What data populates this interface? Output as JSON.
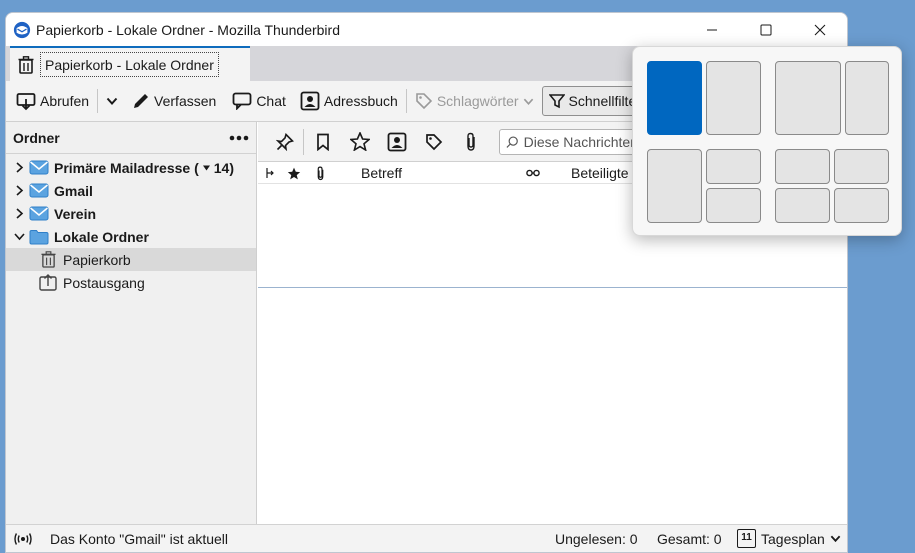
{
  "window": {
    "title": "Papierkorb - Lokale Ordner - Mozilla Thunderbird"
  },
  "tab": {
    "label": "Papierkorb - Lokale Ordner"
  },
  "toolbar": {
    "abrufen": "Abrufen",
    "verfassen": "Verfassen",
    "chat": "Chat",
    "adressbuch": "Adressbuch",
    "schlagwoerter": "Schlagwörter",
    "schnellfilter": "Schnellfilter"
  },
  "folders": {
    "header": "Ordner",
    "accounts": [
      {
        "label": "Primäre Mailadresse (",
        "badge": "14"
      },
      {
        "label": "Gmail"
      },
      {
        "label": "Verein"
      },
      {
        "label": "Lokale Ordner"
      }
    ],
    "subfolders": [
      {
        "label": "Papierkorb"
      },
      {
        "label": "Postausgang"
      }
    ]
  },
  "messages": {
    "search_placeholder": "Diese Nachrichten",
    "columns": {
      "subject": "Betreff",
      "correspondents": "Beteiligte"
    }
  },
  "status": {
    "message": "Das Konto \"Gmail\" ist aktuell",
    "unread": "Ungelesen: 0",
    "total": "Gesamt: 0",
    "today": "Tagesplan",
    "today_day": "11"
  },
  "colors": {
    "accent": "#0f6cbd",
    "snap_active": "#0067c0",
    "desktop": "#6b9ccf"
  }
}
